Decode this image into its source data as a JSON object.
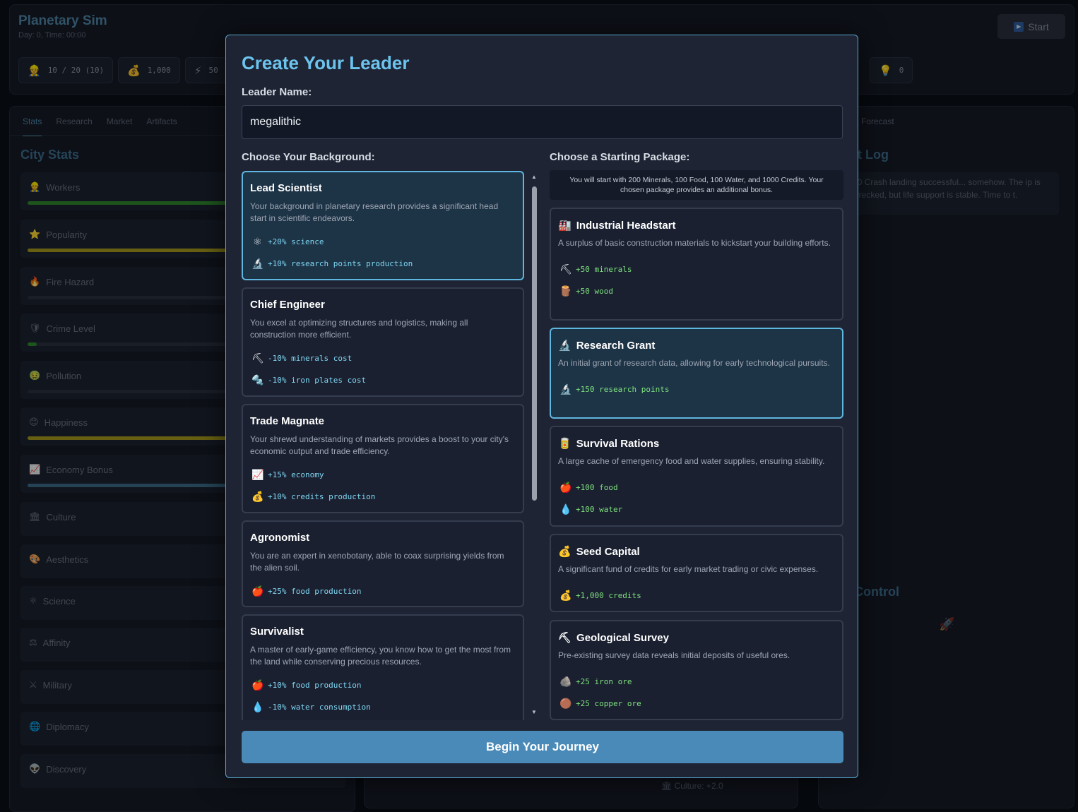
{
  "app": {
    "title": "Planetary Sim",
    "subtitle": "Day: 0, Time: 00:00",
    "start_label": "Start",
    "resources": [
      {
        "icon": "👷",
        "value": "10 / 20 (10)"
      },
      {
        "icon": "💰",
        "value": "1,000"
      },
      {
        "icon": "⚡",
        "value": "50"
      },
      {
        "icon": "💡",
        "value": "0"
      }
    ],
    "tabs": [
      "Stats",
      "Research",
      "Market",
      "Artifacts"
    ],
    "city_stats_title": "City Stats",
    "stats": [
      {
        "icon": "👷",
        "label": "Workers",
        "fill": 1.0,
        "color": "#2f8a2f"
      },
      {
        "icon": "⭐",
        "label": "Popularity",
        "fill": 0.72,
        "color": "#a59a1c"
      },
      {
        "icon": "🔥",
        "label": "Fire Hazard",
        "fill": 0,
        "color": "#8a3a2a"
      },
      {
        "icon": "🛡",
        "label": "Crime Level",
        "fill": 0.03,
        "color": "#2f8a2f"
      },
      {
        "icon": "🤢",
        "label": "Pollution",
        "fill": 0,
        "color": "#2f8a2f"
      },
      {
        "icon": "😊",
        "label": "Happiness",
        "fill": 0.72,
        "color": "#a59a1c"
      },
      {
        "icon": "📈",
        "label": "Economy Bonus",
        "fill": 0.72,
        "color": "#3a6e8c"
      },
      {
        "icon": "🏛",
        "label": "Culture"
      },
      {
        "icon": "🎨",
        "label": "Aesthetics"
      },
      {
        "icon": "⚛",
        "label": "Science"
      },
      {
        "icon": "⚖",
        "label": "Affinity"
      },
      {
        "icon": "⚔",
        "label": "Military"
      },
      {
        "icon": "🌐",
        "label": "Diplomacy"
      },
      {
        "icon": "👽",
        "label": "Discovery"
      }
    ],
    "right_tab": "Forecast",
    "right_log_title": "t Log",
    "right_log_entry": "00 Crash landing successful... somehow. The ip is wrecked, but life support is stable. Time to t.",
    "right_control_title": "Control",
    "bottom_text": "Culture: +2.0"
  },
  "modal": {
    "title": "Create Your Leader",
    "name_label": "Leader Name:",
    "name_value": "megalithic",
    "background_label": "Choose Your Background:",
    "package_label": "Choose a Starting Package:",
    "package_note": "You will start with 200 Minerals, 100 Food, 100 Water, and 1000 Credits. Your chosen package provides an additional bonus.",
    "begin_label": "Begin Your Journey",
    "backgrounds": [
      {
        "name": "Lead Scientist",
        "selected": true,
        "desc": "Your background in planetary research provides a significant head start in scientific endeavors.",
        "bonuses": [
          {
            "icon": "⚛",
            "text": "+20% science"
          },
          {
            "icon": "🔬",
            "text": "+10% research points production"
          }
        ]
      },
      {
        "name": "Chief Engineer",
        "selected": false,
        "desc": "You excel at optimizing structures and logistics, making all construction more efficient.",
        "bonuses": [
          {
            "icon": "⛏",
            "text": "-10% minerals cost"
          },
          {
            "icon": "🔩",
            "text": "-10% iron plates cost"
          }
        ]
      },
      {
        "name": "Trade Magnate",
        "selected": false,
        "desc": "Your shrewd understanding of markets provides a boost to your city's economic output and trade efficiency.",
        "bonuses": [
          {
            "icon": "📈",
            "text": "+15% economy"
          },
          {
            "icon": "💰",
            "text": "+10% credits production"
          }
        ]
      },
      {
        "name": "Agronomist",
        "selected": false,
        "desc": "You are an expert in xenobotany, able to coax surprising yields from the alien soil.",
        "bonuses": [
          {
            "icon": "🍎",
            "text": "+25% food production"
          }
        ]
      },
      {
        "name": "Survivalist",
        "selected": false,
        "desc": "A master of early-game efficiency, you know how to get the most from the land while conserving precious resources.",
        "bonuses": [
          {
            "icon": "🍎",
            "text": "+10% food production"
          },
          {
            "icon": "💧",
            "text": "-10% water consumption"
          }
        ]
      }
    ],
    "packages": [
      {
        "icon": "🏭",
        "name": "Industrial Headstart",
        "selected": false,
        "desc": "A surplus of basic construction materials to kickstart your building efforts.",
        "bonuses": [
          {
            "icon": "⛏",
            "text": "+50 minerals"
          },
          {
            "icon": "🪵",
            "text": "+50 wood"
          }
        ]
      },
      {
        "icon": "🔬",
        "name": "Research Grant",
        "selected": true,
        "desc": "An initial grant of research data, allowing for early technological pursuits.",
        "bonuses": [
          {
            "icon": "🔬",
            "text": "+150 research points"
          }
        ]
      },
      {
        "icon": "🥫",
        "name": "Survival Rations",
        "selected": false,
        "desc": "A large cache of emergency food and water supplies, ensuring stability.",
        "bonuses": [
          {
            "icon": "🍎",
            "text": "+100 food"
          },
          {
            "icon": "💧",
            "text": "+100 water"
          }
        ]
      },
      {
        "icon": "💰",
        "name": "Seed Capital",
        "selected": false,
        "desc": "A significant fund of credits for early market trading or civic expenses.",
        "bonuses": [
          {
            "icon": "💰",
            "text": "+1,000 credits"
          }
        ]
      },
      {
        "icon": "⛏",
        "name": "Geological Survey",
        "selected": false,
        "desc": "Pre-existing survey data reveals initial deposits of useful ores.",
        "bonuses": [
          {
            "icon": "🪨",
            "text": "+25 iron ore"
          },
          {
            "icon": "🟤",
            "text": "+25 copper ore"
          }
        ]
      }
    ]
  }
}
